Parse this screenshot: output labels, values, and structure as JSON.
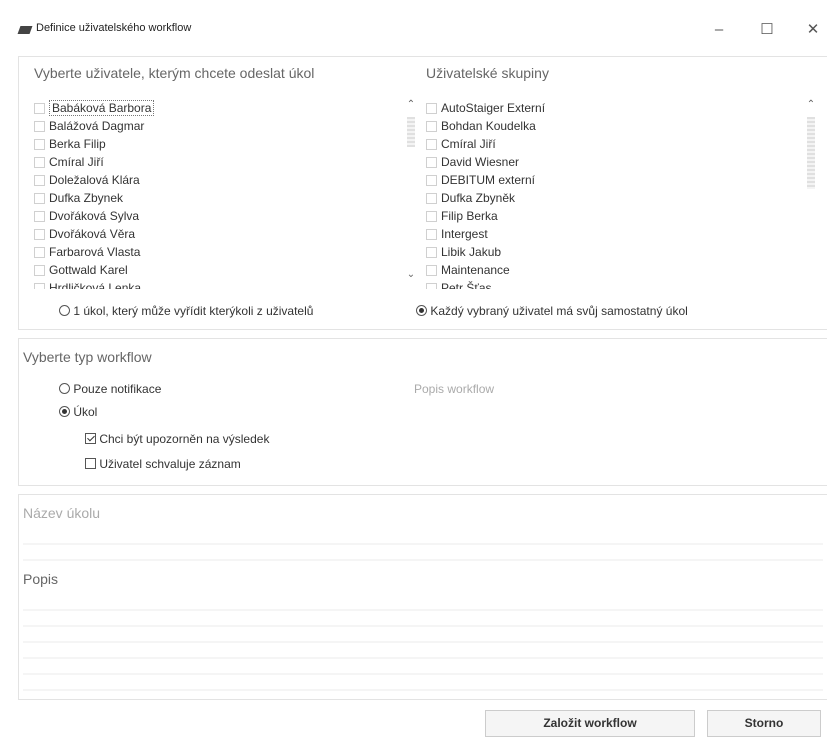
{
  "window": {
    "title": "Definice uživatelského workflow",
    "icon": "workflow-app-icon",
    "controls": {
      "minimize": "–",
      "maximize": "☐",
      "close": "✕"
    }
  },
  "users_section": {
    "heading": "Vyberte uživatele, kterým chcete odeslat úkol",
    "items": [
      "Babáková Barbora",
      "Balážová Dagmar",
      "Berka Filip",
      "Cmíral Jiří",
      "Doležalová Klára",
      "Dufka Zbynek",
      "Dvořáková Sylva",
      "Dvořáková Věra",
      "Farbarová Vlasta",
      "Gottwald Karel",
      "Hrdličková Lenka"
    ],
    "scroll_up": "⌃",
    "scroll_down": "⌄"
  },
  "groups_section": {
    "heading": "Uživatelské skupiny",
    "items": [
      "AutoStaiger Externí",
      "Bohdan Koudelka",
      "Cmíral Jiří",
      "David Wiesner",
      "DEBITUM externí",
      "Dufka Zbyněk",
      "Filip Berka",
      "Intergest",
      "Libik Jakub",
      "Maintenance",
      "Petr Šťas"
    ],
    "scroll_up": "⌃"
  },
  "assignment": {
    "option_single": "1 úkol, který může vyřídit kterýkoli z uživatelů",
    "option_each": "Každý vybraný uživatel má svůj samostatný úkol",
    "selected": "each"
  },
  "workflow_type": {
    "heading": "Vyberte typ workflow",
    "option_notification": "Pouze notifikace",
    "option_task": "Úkol",
    "selected": "task",
    "notify_result_label": "Chci být upozorněn na výsledek",
    "notify_result_checked": true,
    "user_approves_label": "Uživatel schvaluje záznam",
    "user_approves_checked": false,
    "description_placeholder": "Popis workflow"
  },
  "task": {
    "name_label": "Název úkolu",
    "description_label": "Popis"
  },
  "footer": {
    "create_button": "Založit workflow",
    "cancel_button": "Storno"
  }
}
